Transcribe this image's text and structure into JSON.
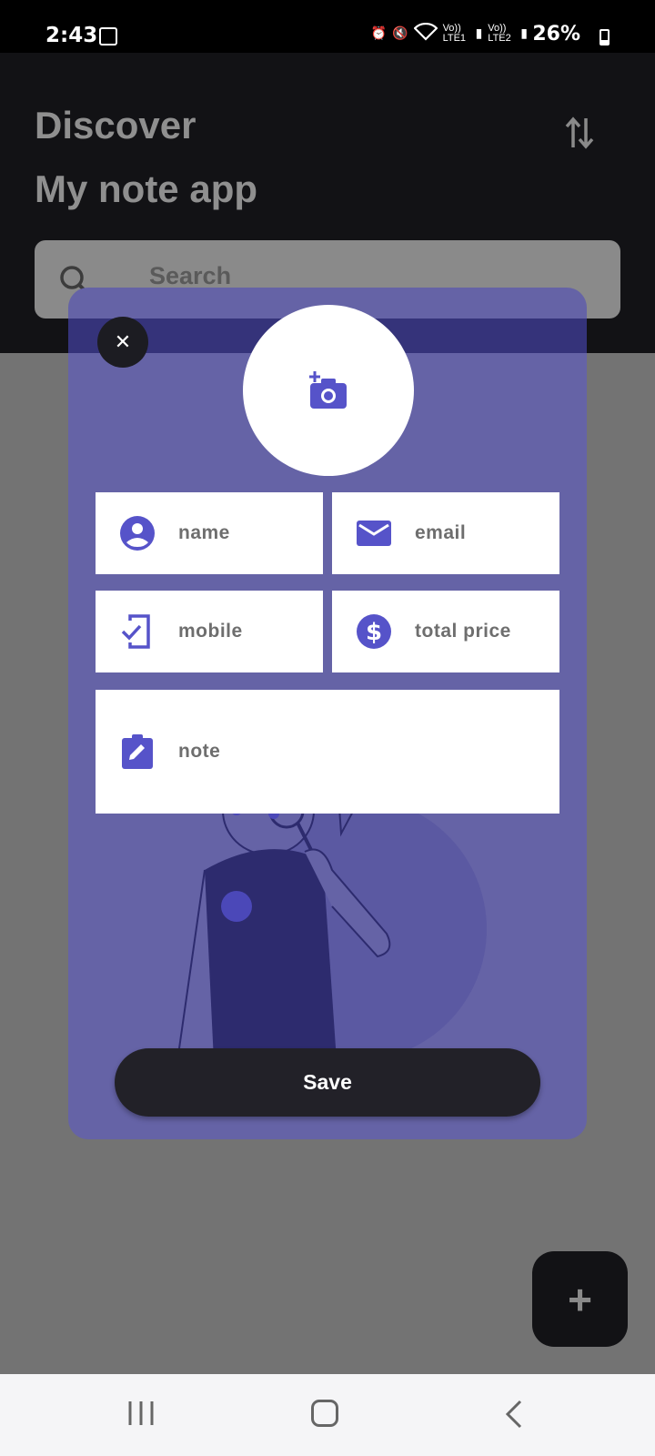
{
  "status_bar": {
    "time": "2:43",
    "battery": "26%",
    "network_labels": [
      "Vo)) LTE1",
      "Vo)) LTE2"
    ]
  },
  "header": {
    "title_line1": "Discover",
    "title_line2": "My note app"
  },
  "search": {
    "placeholder": "Search"
  },
  "dialog": {
    "fields": {
      "name": "name",
      "email": "email",
      "mobile": "mobile",
      "total_price": "total price",
      "note": "note"
    },
    "save_label": "Save"
  },
  "fab_label": "+",
  "colors": {
    "accent": "#5653c9",
    "dialog_bg": "#6563a6",
    "dark": "#121215"
  }
}
